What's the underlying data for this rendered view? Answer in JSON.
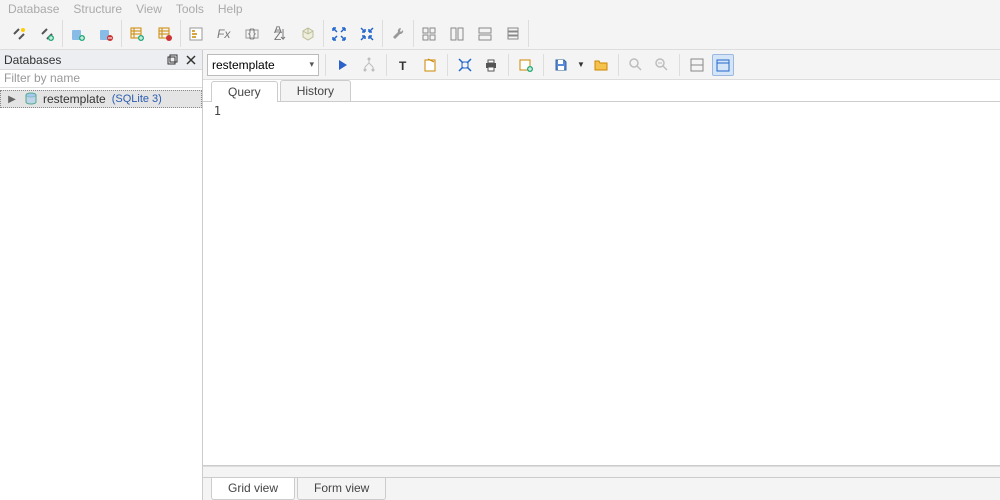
{
  "menubar": {
    "items": [
      "Database",
      "Structure",
      "View",
      "Tools",
      "Help"
    ]
  },
  "sidebar": {
    "title": "Databases",
    "filter_placeholder": "Filter by name",
    "items": [
      {
        "name": "restemplate",
        "type": "(SQLite 3)"
      }
    ]
  },
  "editor_toolbar": {
    "selected_db": "restemplate"
  },
  "query_tabs": {
    "tabs": [
      "Query",
      "History"
    ],
    "active": 0
  },
  "editor": {
    "line_number": "1",
    "content": ""
  },
  "result_tabs": {
    "tabs": [
      "Grid view",
      "Form view"
    ],
    "active": 0
  }
}
